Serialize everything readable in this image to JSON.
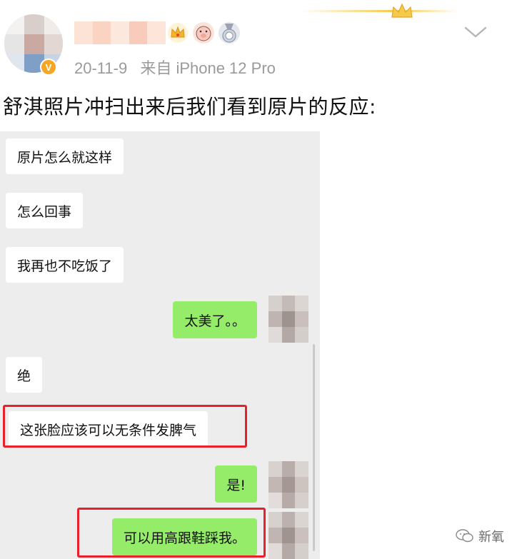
{
  "post": {
    "author": {
      "name": "",
      "verified_badge": "V",
      "badges": [
        "crown-icon",
        "pig-face-icon",
        "medal-icon"
      ]
    },
    "date": "20-11-9",
    "source": "来自 iPhone 12 Pro",
    "text": "舒淇照片冲扫出来后我们看到原片的反应:",
    "menu_icon": "chevron-down-icon"
  },
  "chat": {
    "messages": [
      {
        "side": "received",
        "text": "原片怎么就这样",
        "highlighted": false
      },
      {
        "side": "received",
        "text": "怎么回事",
        "highlighted": false
      },
      {
        "side": "received",
        "text": "我再也不吃饭了",
        "highlighted": false
      },
      {
        "side": "sent",
        "text": "太美了。。",
        "highlighted": false
      },
      {
        "side": "received",
        "text": "绝",
        "highlighted": false
      },
      {
        "side": "received",
        "text": "这张脸应该可以无条件发脾气",
        "highlighted": true
      },
      {
        "side": "sent",
        "text": "是!",
        "highlighted": false
      },
      {
        "side": "sent",
        "text": "可以用高跟鞋踩我。",
        "highlighted": true
      }
    ]
  },
  "watermark": {
    "icon": "wechat-bubble-icon",
    "label": "新氧"
  },
  "colors": {
    "sent_bubble": "#95ec69",
    "received_bubble": "#ffffff",
    "chat_background": "#ededed",
    "highlight_box": "#e8202a",
    "vip_badge": "#f5a623",
    "meta_text": "#9a9a9a"
  }
}
